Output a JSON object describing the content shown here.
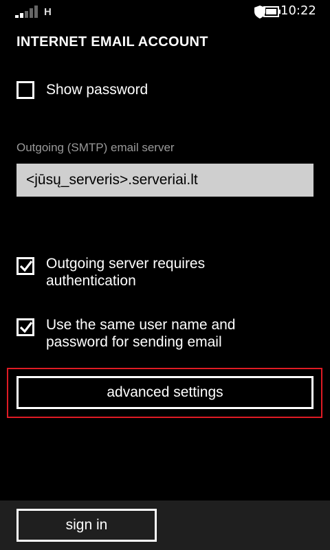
{
  "status_bar": {
    "network_type": "H",
    "time": "10:22",
    "icons": [
      "signal-strength-icon",
      "shield-icon",
      "battery-icon"
    ]
  },
  "page": {
    "title": "INTERNET EMAIL ACCOUNT"
  },
  "show_password": {
    "label": "Show password",
    "checked": false
  },
  "smtp": {
    "label": "Outgoing (SMTP) email server",
    "value": "<jūsų_serveris>.serveriai.lt"
  },
  "auth_required": {
    "label_line1": "Outgoing server requires",
    "label_line2": "authentication",
    "checked": true
  },
  "same_credentials": {
    "label_line1": "Use the same user name and",
    "label_line2": "password for sending email",
    "checked": true
  },
  "advanced": {
    "label": "advanced settings",
    "highlight_color": "#e01b24"
  },
  "app_bar": {
    "signin_label": "sign in",
    "background": "#1f1f1f"
  }
}
